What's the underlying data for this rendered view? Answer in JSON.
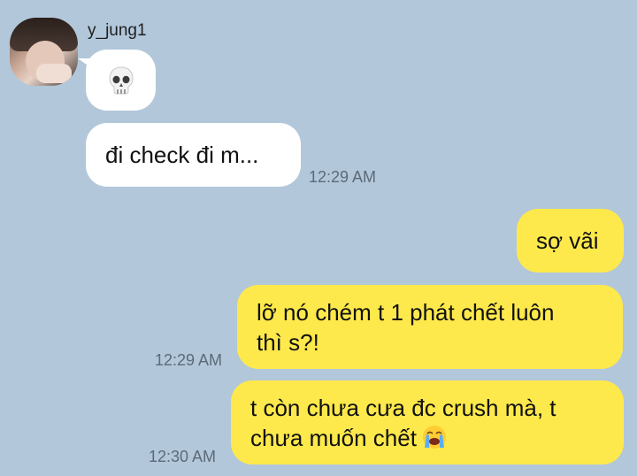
{
  "sender": {
    "name": "y_jung1",
    "avatar_icon": "profile-photo"
  },
  "messages": [
    {
      "direction": "incoming",
      "emoji": "skull-emoji"
    },
    {
      "direction": "incoming",
      "text": "đi check đi m...",
      "time": "12:29 AM"
    },
    {
      "direction": "outgoing",
      "text": "sợ vãi"
    },
    {
      "direction": "outgoing",
      "lines": [
        "lỡ nó chém t 1 phát chết luôn",
        "thì s?!"
      ],
      "time": "12:29 AM"
    },
    {
      "direction": "outgoing",
      "lines": [
        "t còn chưa cưa đc crush mà, t",
        "chưa muốn chết"
      ],
      "emoji": "loudly-crying-face-emoji",
      "time": "12:30 AM"
    }
  ],
  "colors": {
    "background": "#b2c7da",
    "incoming_bubble": "#ffffff",
    "outgoing_bubble": "#fde94b",
    "timestamp": "#5c6a77"
  }
}
